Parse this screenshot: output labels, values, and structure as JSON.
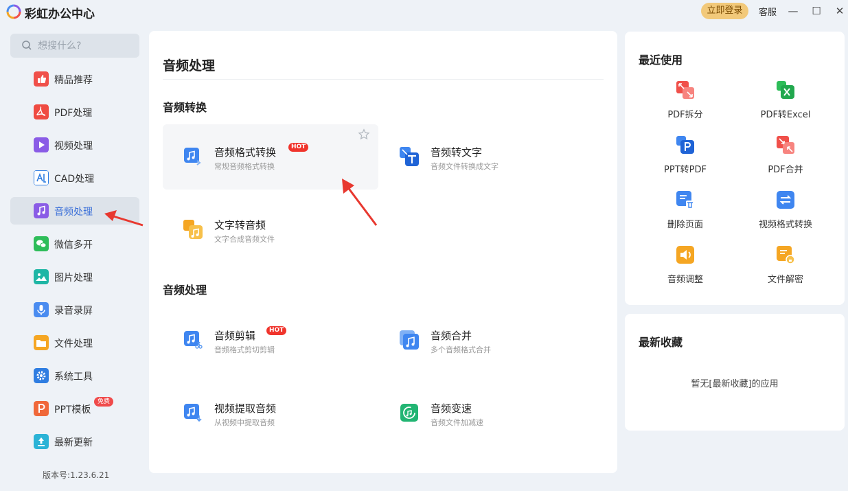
{
  "app": {
    "title": "彩虹办公中心",
    "login_label": "立即登录",
    "service_label": "客服",
    "minimize_glyph": "—",
    "maximize_glyph": "☐",
    "close_glyph": "✕"
  },
  "sidebar": {
    "search_placeholder": "想搜什么?",
    "items": [
      {
        "label": "精品推荐",
        "icon": "thumbs-up-icon",
        "color": "#f0504a"
      },
      {
        "label": "PDF处理",
        "icon": "pdf-icon",
        "color": "#ef4b42"
      },
      {
        "label": "视频处理",
        "icon": "play-icon",
        "color": "#8a5ce6"
      },
      {
        "label": "CAD处理",
        "icon": "cad-icon",
        "color": "#2f7de1"
      },
      {
        "label": "音频处理",
        "icon": "music-icon",
        "color": "#8a5ce6"
      },
      {
        "label": "微信多开",
        "icon": "wechat-icon",
        "color": "#2ebd59"
      },
      {
        "label": "图片处理",
        "icon": "image-icon",
        "color": "#1fb6a5"
      },
      {
        "label": "录音录屏",
        "icon": "microphone-icon",
        "color": "#4a8cf0"
      },
      {
        "label": "文件处理",
        "icon": "folder-icon",
        "color": "#f5a623"
      },
      {
        "label": "系统工具",
        "icon": "gear-icon",
        "color": "#2f7de1"
      },
      {
        "label": "PPT模板",
        "icon": "ppt-icon",
        "color": "#f0683a",
        "badge": "免费"
      },
      {
        "label": "最新更新",
        "icon": "upload-icon",
        "color": "#2bb3d6"
      }
    ],
    "version": "版本号:1.23.6.21"
  },
  "main": {
    "title": "音频处理",
    "sections": [
      {
        "title": "音频转换",
        "tools": [
          {
            "title": "音频格式转换",
            "desc": "常规音频格式转换",
            "badge": "HOT",
            "icon": "audio-convert-icon"
          },
          {
            "title": "音频转文字",
            "desc": "音频文件转换成文字",
            "icon": "audio-to-text-icon"
          },
          {
            "title": "文字转音频",
            "desc": "文字合成音频文件",
            "icon": "text-to-audio-icon"
          }
        ]
      },
      {
        "title": "音频处理",
        "tools": [
          {
            "title": "音频剪辑",
            "desc": "音频格式剪切剪辑",
            "badge": "HOT",
            "icon": "audio-cut-icon"
          },
          {
            "title": "音频合并",
            "desc": "多个音频格式合并",
            "icon": "audio-merge-icon"
          },
          {
            "title": "视频提取音频",
            "desc": "从视频中提取音频",
            "icon": "video-extract-audio-icon"
          },
          {
            "title": "音频变速",
            "desc": "音频文件加减速",
            "icon": "audio-speed-icon"
          }
        ]
      }
    ]
  },
  "recent": {
    "title": "最近使用",
    "items": [
      {
        "label": "PDF拆分",
        "icon": "pdf-split-icon",
        "color": "#f0504a"
      },
      {
        "label": "PDF转Excel",
        "icon": "pdf-to-excel-icon",
        "color": "#2ebd59"
      },
      {
        "label": "PPT转PDF",
        "icon": "ppt-to-pdf-icon",
        "color": "#2f7de1"
      },
      {
        "label": "PDF合并",
        "icon": "pdf-merge-icon",
        "color": "#f0504a"
      },
      {
        "label": "删除页面",
        "icon": "delete-page-icon",
        "color": "#2f7de1"
      },
      {
        "label": "视频格式转换",
        "icon": "video-convert-icon",
        "color": "#2f7de1"
      },
      {
        "label": "音频调整",
        "icon": "audio-adjust-icon",
        "color": "#f5a623"
      },
      {
        "label": "文件解密",
        "icon": "file-decrypt-icon",
        "color": "#f5a623"
      }
    ]
  },
  "favorites": {
    "title": "最新收藏",
    "empty_text": "暂无[最新收藏]的应用"
  }
}
